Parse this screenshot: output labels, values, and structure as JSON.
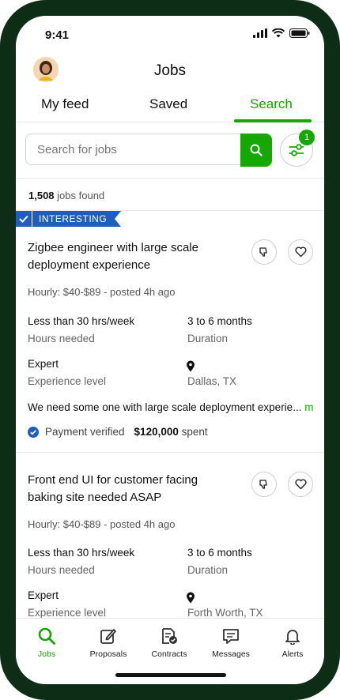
{
  "status_bar": {
    "time": "9:41"
  },
  "header": {
    "title": "Jobs"
  },
  "tabs": [
    {
      "label": "My feed"
    },
    {
      "label": "Saved"
    },
    {
      "label": "Search",
      "active": true
    }
  ],
  "search": {
    "placeholder": "Search for jobs",
    "filter_count": "1"
  },
  "results": {
    "count": "1,508",
    "suffix": "jobs found"
  },
  "ribbon": {
    "label": "INTERESTING"
  },
  "jobs": [
    {
      "title": "Zigbee engineer with large scale deployment experience",
      "rate_posted": "Hourly: $40-$89 - posted 4h ago",
      "hours_value": "Less than 30 hrs/week",
      "hours_label": "Hours needed",
      "duration_value": "3 to 6 months",
      "duration_label": "Duration",
      "level_value": "Expert",
      "level_label": "Experience level",
      "location": "Dallas, TX",
      "description": "We need some one with large scale deployment experie...",
      "more_label": "more",
      "payment_label": "Payment verified",
      "spent_amount": "$120,000",
      "spent_suffix": "spent"
    },
    {
      "title": "Front end UI for customer facing baking site needed ASAP",
      "rate_posted": "Hourly: $40-$89 - posted 4h ago",
      "hours_value": "Less than 30 hrs/week",
      "hours_label": "Hours needed",
      "duration_value": "3 to 6 months",
      "duration_label": "Duration",
      "level_value": "Expert",
      "level_label": "Experience level",
      "location": "Forth Worth, TX"
    }
  ],
  "bottom_nav": [
    {
      "label": "Jobs",
      "icon": "search-icon",
      "active": true
    },
    {
      "label": "Proposals",
      "icon": "edit-icon"
    },
    {
      "label": "Contracts",
      "icon": "contract-icon"
    },
    {
      "label": "Messages",
      "icon": "message-icon"
    },
    {
      "label": "Alerts",
      "icon": "bell-icon"
    }
  ],
  "colors": {
    "accent": "#14a800",
    "ribbon": "#1d5fbf",
    "frame": "#0e2d17"
  }
}
